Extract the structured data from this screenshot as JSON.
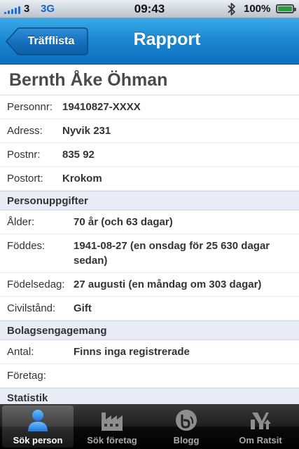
{
  "status_bar": {
    "carrier": "3",
    "network": "3G",
    "time": "09:43",
    "battery": "100%",
    "battery_level": 1.0
  },
  "nav": {
    "back_label": "Träfflista",
    "title": "Rapport"
  },
  "person": {
    "name": "Bernth Åke Öhman",
    "fields": [
      {
        "label": "Personnr:",
        "value": "19410827-XXXX"
      },
      {
        "label": "Adress:",
        "value": "Nyvik 231"
      },
      {
        "label": "Postnr:",
        "value": "835 92"
      },
      {
        "label": "Postort:",
        "value": "Krokom"
      }
    ]
  },
  "sections": {
    "personuppgifter": {
      "title": "Personuppgifter",
      "fields": [
        {
          "label": "Ålder:",
          "value": "70 år (och 63 dagar)"
        },
        {
          "label": "Föddes:",
          "value": "1941-08-27 (en onsdag för 25 630 dagar sedan)"
        },
        {
          "label": "Födelsedag:",
          "value": "27 augusti (en måndag om 303 dagar)"
        },
        {
          "label": "Civilstånd:",
          "value": "Gift"
        }
      ]
    },
    "bolagsengagemang": {
      "title": "Bolagsengagemang",
      "fields": [
        {
          "label": "Antal:",
          "value": "Finns inga registrerade"
        },
        {
          "label": "Företag:",
          "value": ""
        }
      ]
    },
    "statistik": {
      "title": "Statistik"
    }
  },
  "tabs": [
    {
      "label": "Sök person",
      "icon": "person-icon",
      "active": true
    },
    {
      "label": "Sök företag",
      "icon": "factory-icon",
      "active": false
    },
    {
      "label": "Blogg",
      "icon": "blog-icon",
      "active": false
    },
    {
      "label": "Om Ratsit",
      "icon": "ratsit-logo-icon",
      "active": false
    }
  ],
  "colors": {
    "nav_blue": "#1a86d2",
    "section_bg": "#e7ecf6",
    "tab_active_icon": "#2f8fe6"
  }
}
